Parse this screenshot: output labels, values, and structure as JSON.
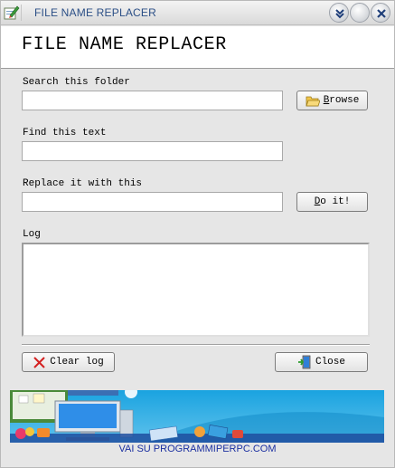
{
  "window": {
    "title": "FILE NAME REPLACER"
  },
  "header": {
    "title": "FILE NAME REPLACER"
  },
  "search": {
    "label": "Search this folder",
    "value": "",
    "browse_label": "rowse",
    "browse_accel": "B"
  },
  "find": {
    "label": "Find this text",
    "value": ""
  },
  "replace": {
    "label": "Replace it with this",
    "value": "",
    "do_it_accel": "D",
    "do_it_label": "o it!"
  },
  "log": {
    "label": "Log",
    "value": ""
  },
  "buttons": {
    "clear_log": "Clear log",
    "close": "Close"
  },
  "banner": {
    "link_text": "VAI SU PROGRAMMIPERPC.COM"
  },
  "icons": {
    "app": "app-pencil-icon",
    "browse": "folder-icon",
    "clear": "red-x-icon",
    "close": "exit-door-icon"
  },
  "colors": {
    "title_text": "#2b4f86",
    "banner_link": "#1b2fa0",
    "banner_sky": "#1aa3e0"
  }
}
